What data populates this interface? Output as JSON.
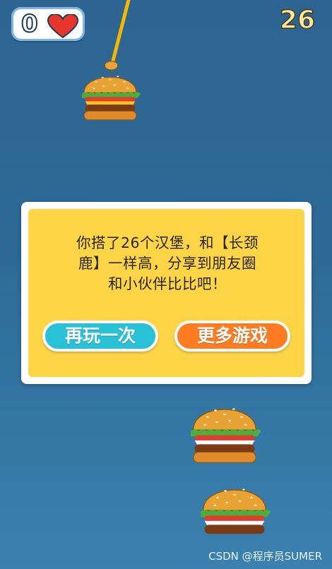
{
  "hud": {
    "lives": "0",
    "score": "26"
  },
  "dialog": {
    "message_line1": "你搭了26个汉堡，和【长颈",
    "message_line2": "鹿】一样高，分享到朋友圈",
    "message_line3": "和小伙伴比比吧！",
    "replay_label": "再玩一次",
    "more_games_label": "更多游戏"
  },
  "watermark": "CSDN @程序员SUMER",
  "colors": {
    "background": "#2e6492",
    "dialog_panel": "#fed547",
    "replay_button": "#29c1d6",
    "more_games_button": "#ff7c22",
    "heart": "#e8362c",
    "rope": "#f5b700"
  },
  "icons": {
    "lives": "heart-icon"
  }
}
